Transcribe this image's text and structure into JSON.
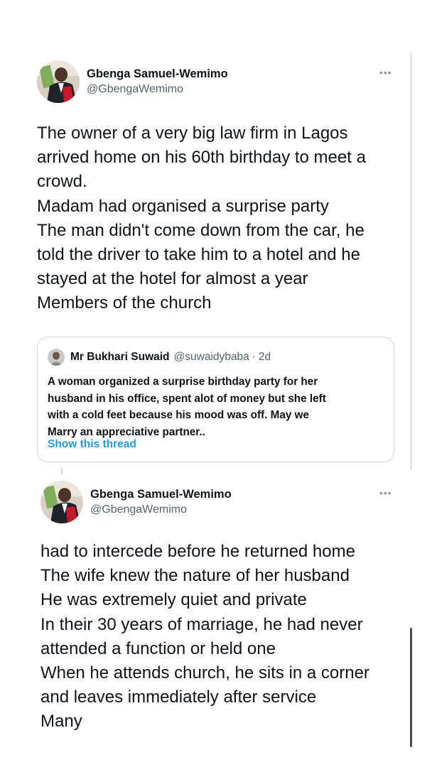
{
  "tweet1": {
    "display_name": "Gbenga Samuel-Wemimo",
    "handle": "@GbengaWemimo",
    "more_icon": "more-horizontal-icon",
    "lines": [
      "The owner of a very big law firm in Lagos",
      "arrived home on his 60th birthday to meet a",
      "crowd.",
      "Madam had organised a surprise party",
      "The man didn't come down from the car, he",
      "told the driver to take him to a hotel and he",
      "stayed at the hotel for almost a year",
      "Members of the church"
    ]
  },
  "quote": {
    "display_name": "Mr Bukhari Suwaid",
    "handle": "@suwaidybaba",
    "separator": "·",
    "time": "2d",
    "lines": [
      "A woman organized a surprise birthday party for her",
      "husband in his  office, spent alot of money but she left",
      "with a cold feet because his mood was off. May we",
      "Marry an appreciative partner.."
    ],
    "show_thread": "Show this thread"
  },
  "tweet2": {
    "display_name": "Gbenga Samuel-Wemimo",
    "handle": "@GbengaWemimo",
    "more_icon": "more-horizontal-icon",
    "lines": [
      "had to intercede before he returned home",
      "The wife knew the nature of her husband",
      "He was extremely quiet and private",
      "In their 30 years of marriage, he had never",
      "attended a function or held one",
      "When he attends church, he sits in a corner",
      "and leaves immediately after service",
      "Many"
    ]
  },
  "colors": {
    "text": "#0f1419",
    "secondary": "#536471",
    "link": "#1d9bf0",
    "border": "#cfd9de"
  }
}
